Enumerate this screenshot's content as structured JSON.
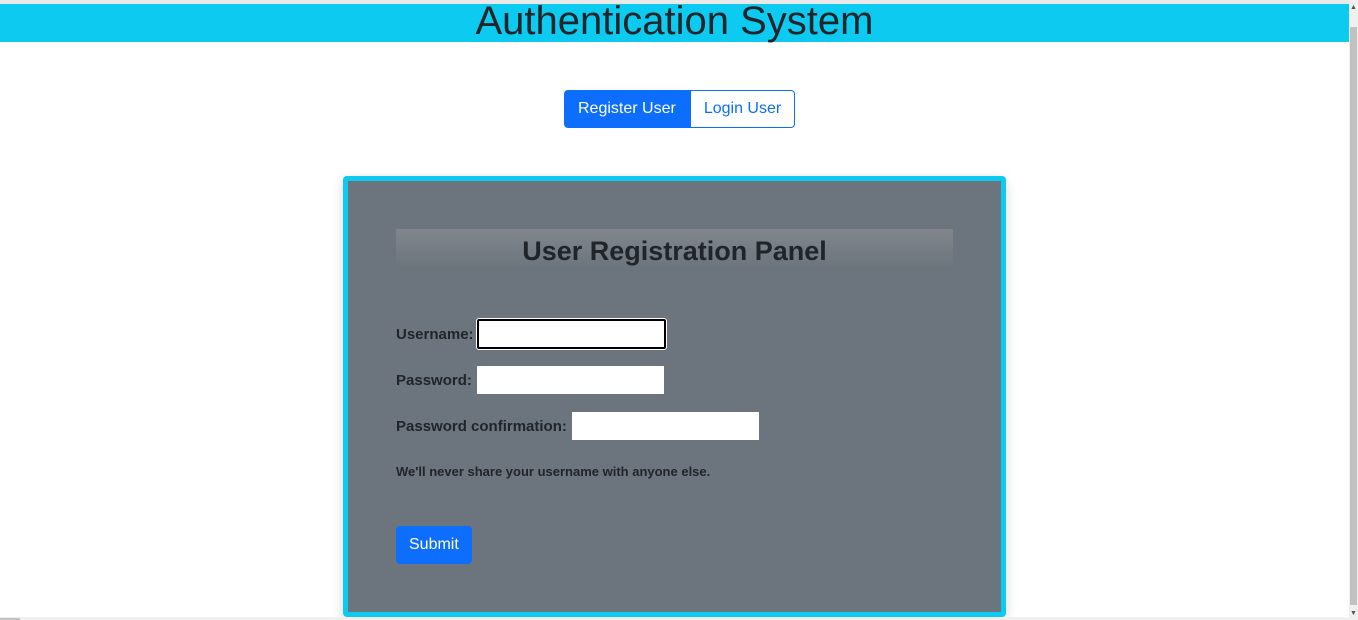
{
  "header": {
    "title": "Authentication System"
  },
  "nav": {
    "register_label": "Register User",
    "login_label": "Login User"
  },
  "panel": {
    "title": "User Registration Panel",
    "username_label": "Username:",
    "username_value": "",
    "password_label": "Password:",
    "password_value": "",
    "confirm_label": "Password confirmation:",
    "confirm_value": "",
    "note": "We'll never share your username with anyone else.",
    "submit_label": "Submit"
  },
  "colors": {
    "header_bg": "#0dcaf0",
    "primary": "#0d6efd",
    "panel_bg": "#6c757d"
  }
}
